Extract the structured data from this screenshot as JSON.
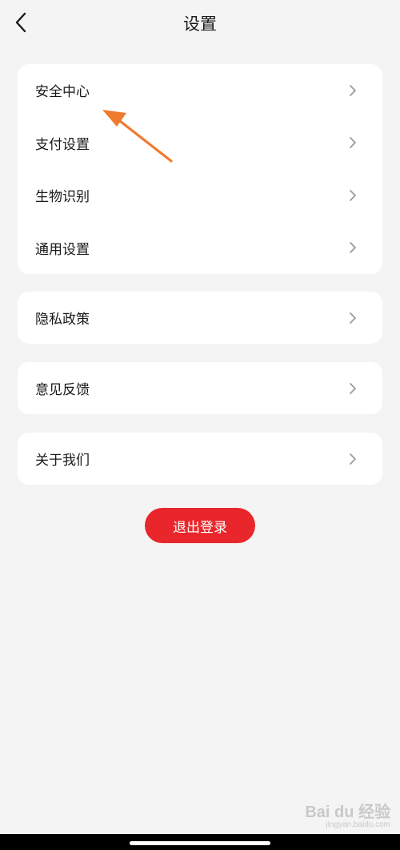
{
  "header": {
    "title": "设置",
    "back_icon": "chevron-left-icon"
  },
  "groups": [
    {
      "items": [
        {
          "label": "安全中心"
        },
        {
          "label": "支付设置"
        },
        {
          "label": "生物识别"
        },
        {
          "label": "通用设置"
        }
      ]
    },
    {
      "items": [
        {
          "label": "隐私政策"
        }
      ]
    },
    {
      "items": [
        {
          "label": "意见反馈"
        }
      ]
    },
    {
      "items": [
        {
          "label": "关于我们"
        }
      ]
    }
  ],
  "logout": {
    "label": "退出登录",
    "color": "#e8262b"
  },
  "annotation": {
    "color": "#f07a2e"
  },
  "watermark": {
    "logo": "Bai du 经验",
    "url": "jingyan.baidu.com"
  }
}
